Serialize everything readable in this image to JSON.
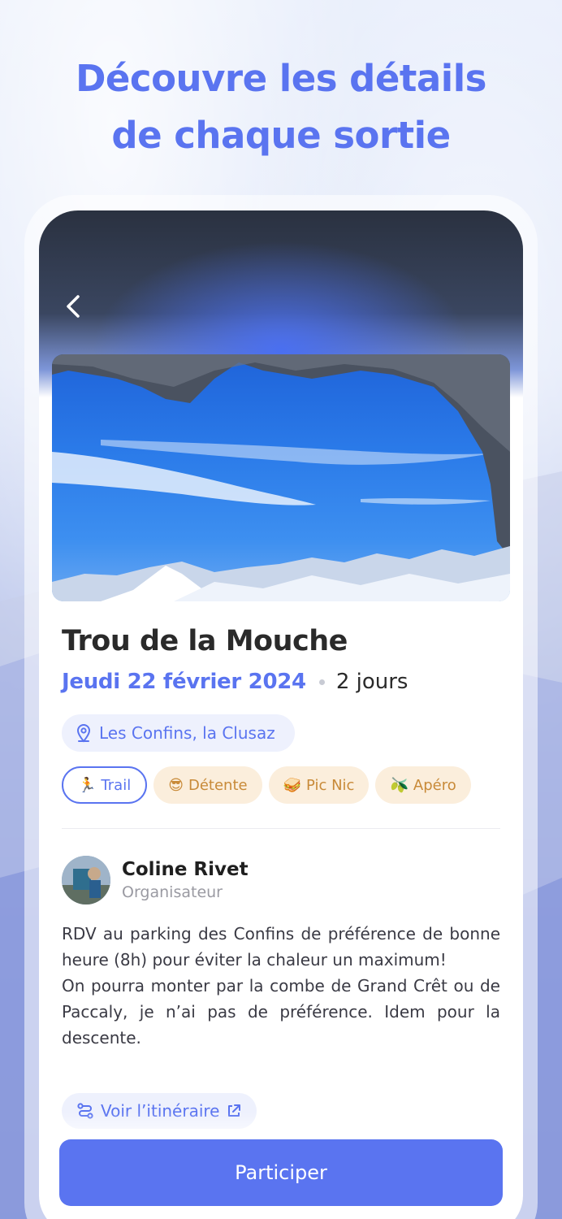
{
  "headline": {
    "line1": "Découvre les détails",
    "line2": "de chaque sortie"
  },
  "event": {
    "title": "Trou de la Mouche",
    "date": "Jeudi 22 février 2024",
    "duration": "2 jours",
    "location": "Les Confins, la Clusaz",
    "tags": [
      {
        "emoji": "🏃",
        "label": "Trail",
        "active": true
      },
      {
        "emoji": "😎",
        "label": "Détente",
        "active": false
      },
      {
        "emoji": "🥪",
        "label": "Pic Nic",
        "active": false
      },
      {
        "emoji": "🫒",
        "label": "Apéro",
        "active": false
      }
    ]
  },
  "organizer": {
    "name": "Coline Rivet",
    "role": "Organisateur"
  },
  "description": {
    "line1": "RDV au parking des Confins de préférence de bonne heure (8h) pour éviter la chaleur un maximum!",
    "line2": "On pourra monter par la combe de Grand Crêt ou de Paccaly, je n’ai pas de préférence. Idem pour la descente."
  },
  "route_link": "Voir l’itinéraire",
  "cta": "Participer",
  "colors": {
    "accent": "#5a74f0",
    "tag_neutral_bg": "#fbeedc",
    "tag_neutral_text": "#c88a38",
    "pill_bg": "#eef1fd"
  }
}
